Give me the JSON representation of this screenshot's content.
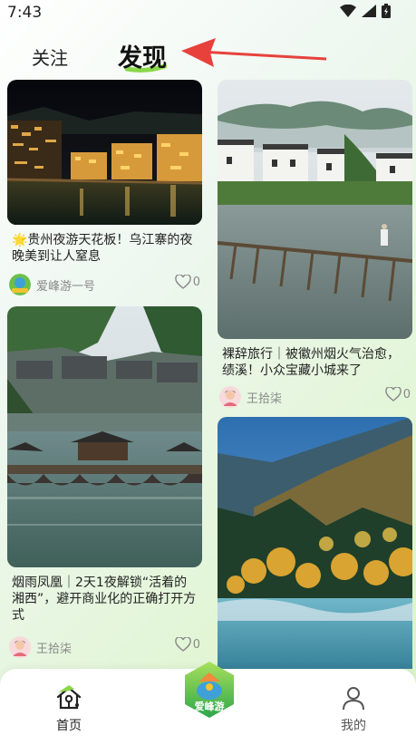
{
  "status": {
    "time": "7:43"
  },
  "tabs": {
    "follow": "关注",
    "discover": "发现"
  },
  "feed": {
    "left": [
      {
        "title": "🌟贵州夜游天花板！乌江寨的夜晚美到让人窒息",
        "author": "爱峰游一号",
        "likes": "0",
        "image": "night-village-river"
      },
      {
        "title": "烟雨凤凰｜2天1夜解锁“活着的湘西”，避开商业化的正确打开方式",
        "author": "王拾柒",
        "likes": "0",
        "image": "fenghuang-bridge"
      }
    ],
    "right": [
      {
        "title": "裸辞旅行｜被徽州烟火气治愈，绩溪！小众宝藏小城来了",
        "author": "王拾柒",
        "likes": "0",
        "image": "huizhou-village-bridge"
      },
      {
        "title": "",
        "author": "",
        "likes": "",
        "image": "autumn-lake-mountains"
      }
    ]
  },
  "bottom_nav": {
    "home": "首页",
    "center_logo_text": "爱峰游",
    "me": "我的"
  },
  "colors": {
    "accent_green": "#8ad84a",
    "arrow_red": "#e8413c"
  }
}
